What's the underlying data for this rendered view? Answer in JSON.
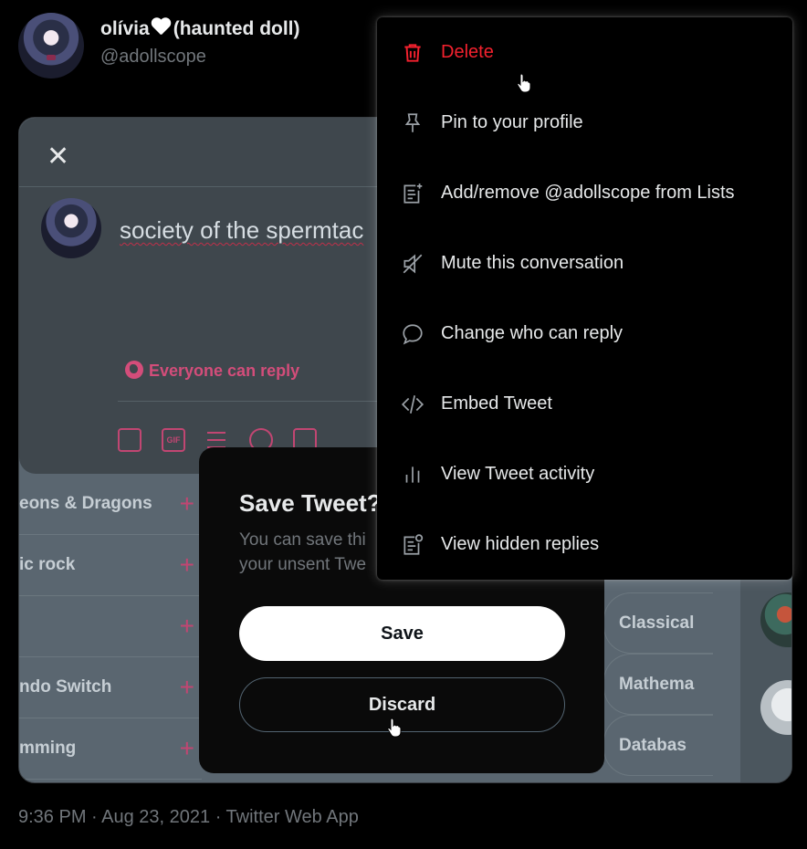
{
  "tweet": {
    "author_name_part1": "olívia",
    "author_name_part2": "(haunted doll)",
    "author_handle": "@adollscope",
    "meta": "9:36 PM · Aug 23, 2021 · Twitter Web App"
  },
  "embedded": {
    "compose_text": "society of the spermtac",
    "reply_setting": "Everyone can reply",
    "toolbar_icons": [
      "image-icon",
      "gif-icon",
      "poll-icon",
      "emoji-icon",
      "schedule-icon"
    ],
    "gif_label": "GIF",
    "topics_left": [
      "eons & Dragons",
      "ic rock",
      "",
      "ndo Switch",
      "mming"
    ],
    "topics_right": [
      "Classical",
      "Mathema",
      "Databas"
    ],
    "save_dialog": {
      "title": "Save Tweet?",
      "description_line1": "You can save thi",
      "description_line2": "your unsent Twe",
      "save_label": "Save",
      "discard_label": "Discard"
    }
  },
  "menu": {
    "items": [
      {
        "label": "Delete",
        "icon": "trash-icon"
      },
      {
        "label": "Pin to your profile",
        "icon": "pin-icon"
      },
      {
        "label": "Add/remove @adollscope from Lists",
        "icon": "list-add-icon"
      },
      {
        "label": "Mute this conversation",
        "icon": "mute-icon"
      },
      {
        "label": "Change who can reply",
        "icon": "reply-bubble-icon"
      },
      {
        "label": "Embed Tweet",
        "icon": "code-icon"
      },
      {
        "label": "View Tweet activity",
        "icon": "activity-icon"
      },
      {
        "label": "View hidden replies",
        "icon": "hidden-replies-icon"
      }
    ]
  },
  "colors": {
    "background": "#000000",
    "danger": "#f4212e",
    "accent_pink": "#c14672",
    "muted": "#71767b"
  }
}
